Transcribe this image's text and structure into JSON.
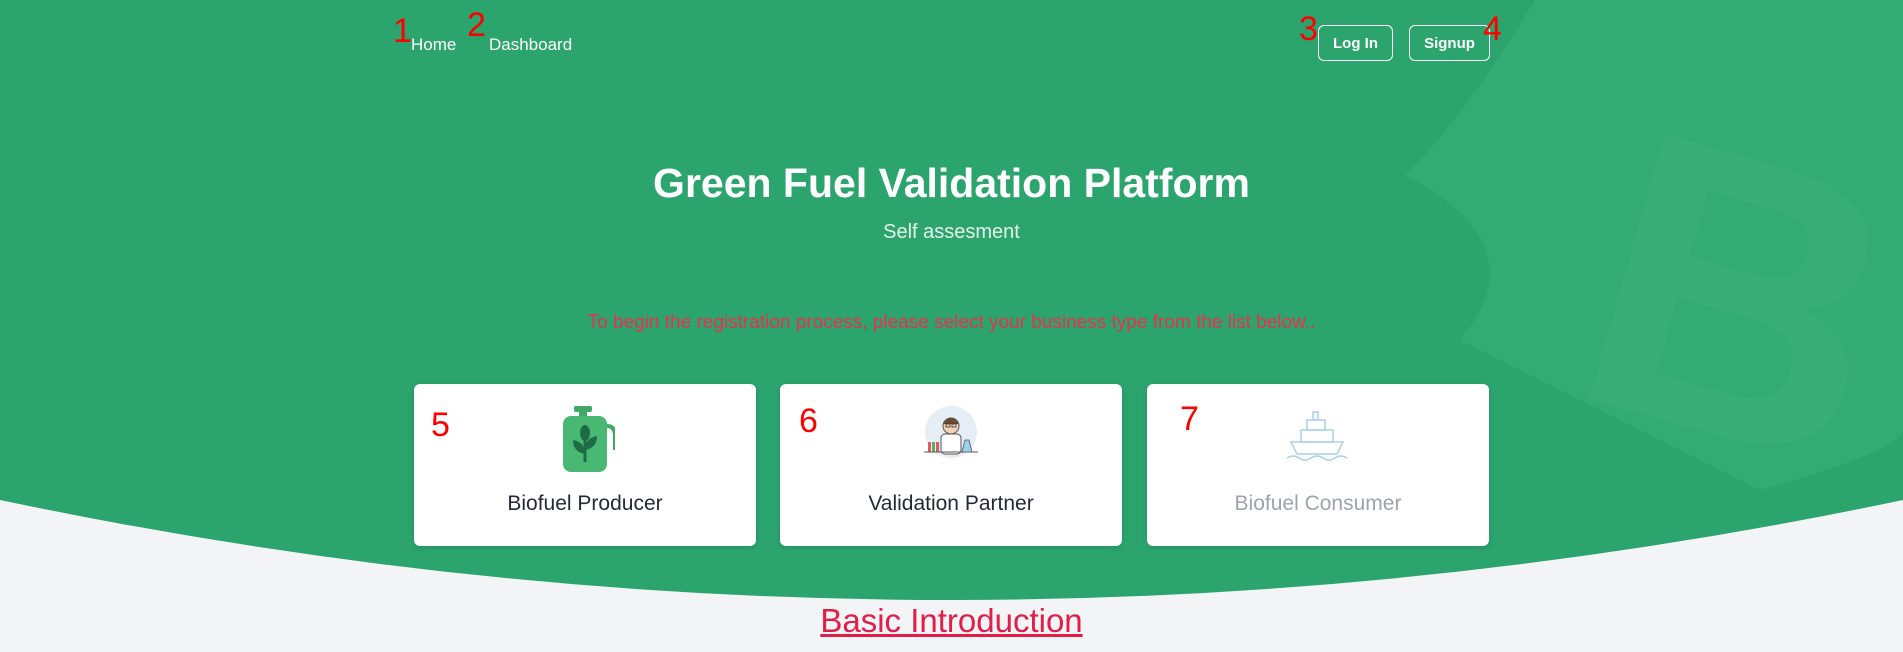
{
  "nav": {
    "home_label": "Home",
    "dashboard_label": "Dashboard",
    "login_label": "Log In",
    "signup_label": "Signup"
  },
  "hero": {
    "title": "Green Fuel Validation Platform",
    "subtitle": "Self assesment",
    "instruction": "To begin the registration process, please select your business type from the list below.."
  },
  "cards": [
    {
      "label": "Biofuel Producer",
      "icon": "fuel-canister-leaf-icon",
      "enabled": true
    },
    {
      "label": "Validation Partner",
      "icon": "scientist-lab-icon",
      "enabled": true
    },
    {
      "label": "Biofuel Consumer",
      "icon": "cargo-ship-icon",
      "enabled": false
    }
  ],
  "intro_link": "Basic Introduction",
  "markers": [
    "1",
    "2",
    "3",
    "4",
    "5",
    "6",
    "7"
  ],
  "colors": {
    "hero_green": "#2ca46e",
    "accent_red": "#e11d48",
    "background": "#f3f4f6"
  }
}
